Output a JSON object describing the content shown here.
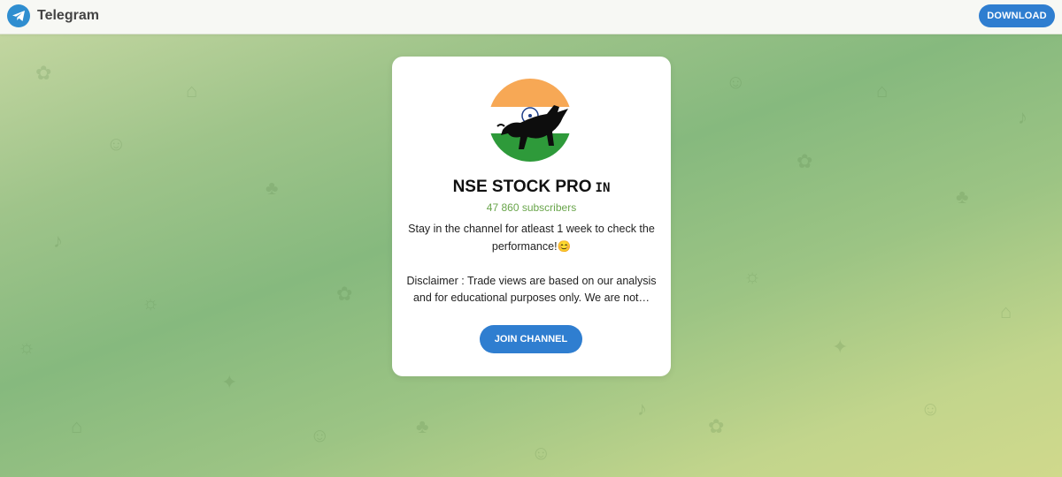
{
  "header": {
    "app_name": "Telegram",
    "download_label": "DOWNLOAD"
  },
  "channel": {
    "name": "NSE STOCK PRO",
    "flag_text": "IN",
    "subscribers": "47 860 subscribers",
    "description": "Stay in the channel for atleast 1 week to check the performance!😊\n\nDisclaimer : Trade views are based on our analysis and for educational purposes only. We are not…",
    "join_label": "JOIN CHANNEL"
  },
  "colors": {
    "accent": "#2f7ed0",
    "subscribers": "#69a54b"
  },
  "icons": {
    "logo": "telegram-logo-icon"
  }
}
